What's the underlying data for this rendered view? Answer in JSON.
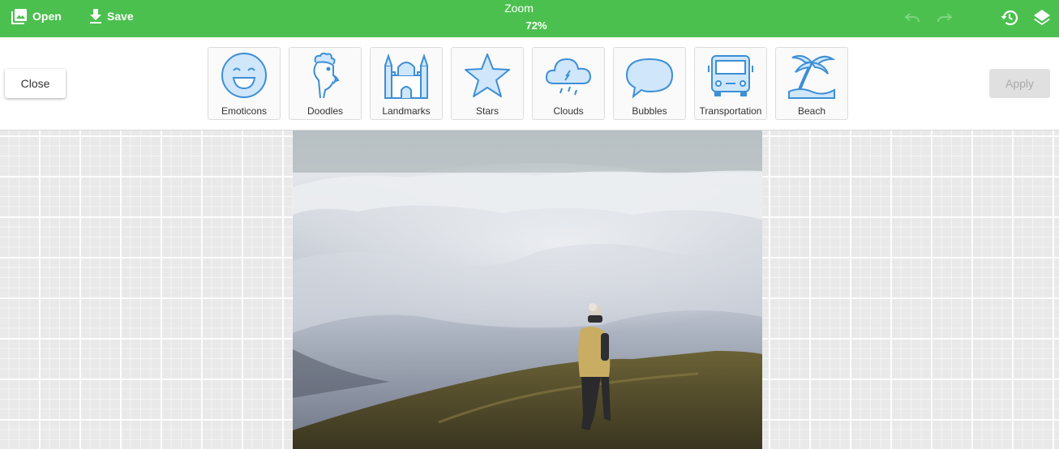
{
  "topbar": {
    "open_label": "Open",
    "save_label": "Save",
    "zoom_label": "Zoom",
    "zoom_value": "72%",
    "icons": [
      "image-icon",
      "download-icon",
      "undo-icon",
      "redo-icon",
      "history-icon",
      "layers-icon"
    ]
  },
  "toolbar": {
    "close_label": "Close",
    "apply_label": "Apply",
    "stickers": [
      {
        "label": "Emoticons",
        "icon": "emoticon-icon"
      },
      {
        "label": "Doodles",
        "icon": "rooster-icon"
      },
      {
        "label": "Landmarks",
        "icon": "castle-icon"
      },
      {
        "label": "Stars",
        "icon": "star-icon"
      },
      {
        "label": "Clouds",
        "icon": "cloud-icon"
      },
      {
        "label": "Bubbles",
        "icon": "speech-bubble-icon"
      },
      {
        "label": "Transportation",
        "icon": "bus-icon"
      },
      {
        "label": "Beach",
        "icon": "palm-tree-icon"
      }
    ]
  },
  "colors": {
    "accent": "#4bc04e",
    "sticker_stroke": "#3d8fd6",
    "sticker_fill": "#cfe6fb"
  }
}
